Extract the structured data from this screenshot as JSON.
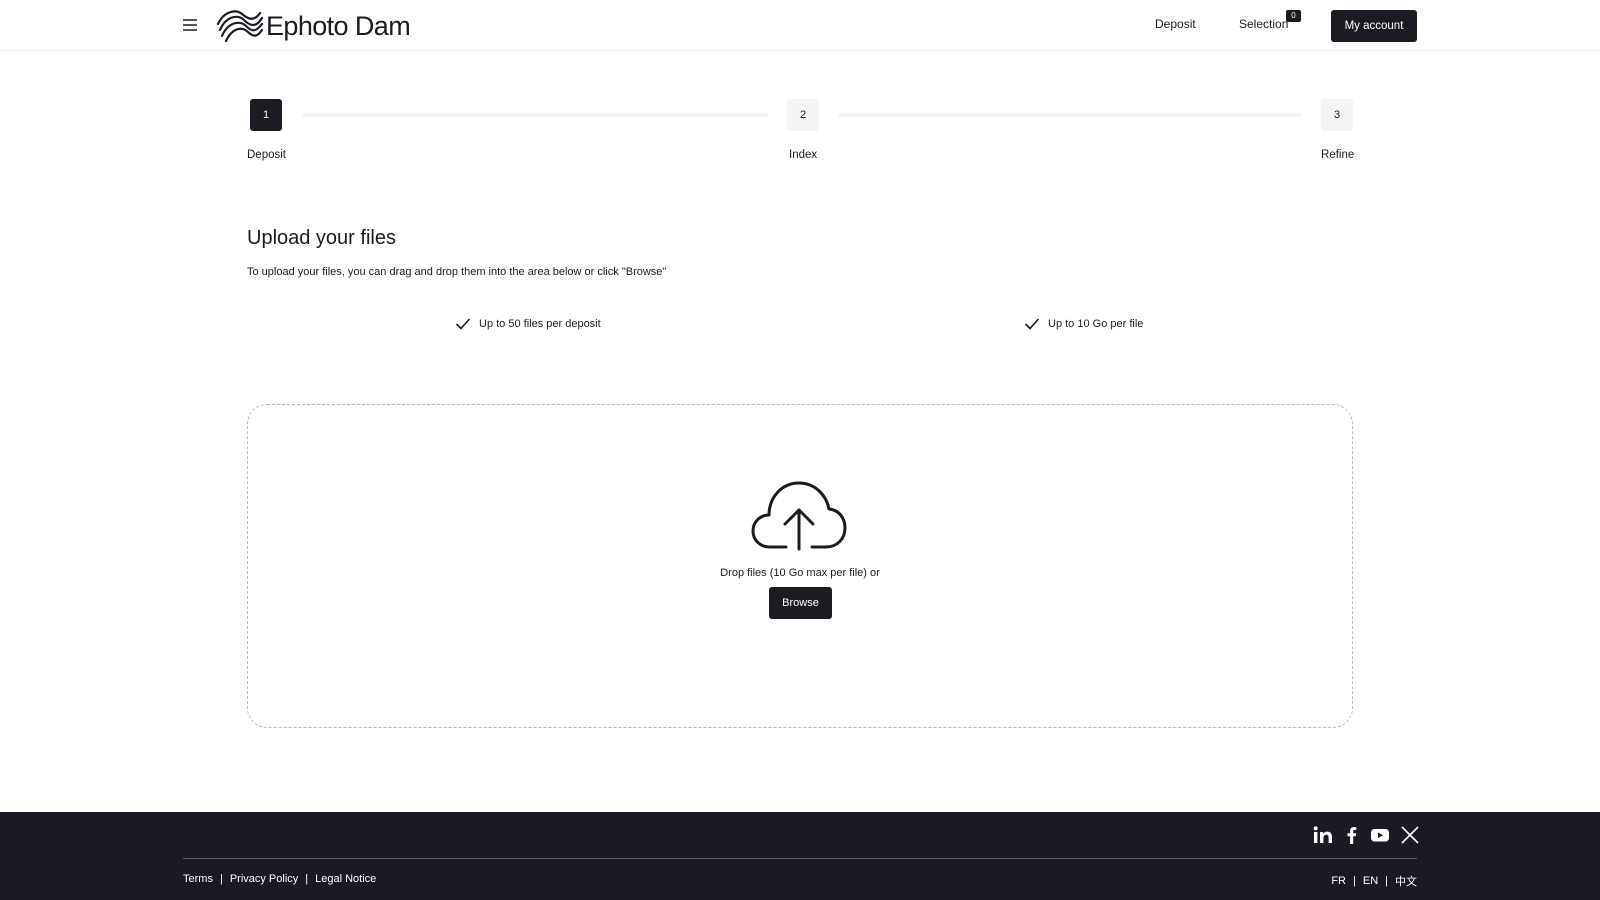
{
  "header": {
    "brand": "Ephoto Dam",
    "nav": {
      "deposit": "Deposit",
      "selection": "Selection",
      "selection_count": "0"
    },
    "account": "My account"
  },
  "stepper": {
    "steps": [
      {
        "number": "1",
        "label": "Deposit"
      },
      {
        "number": "2",
        "label": "Index"
      },
      {
        "number": "3",
        "label": "Refine"
      }
    ]
  },
  "upload": {
    "title": "Upload your files",
    "subtitle": "To upload your files, you can drag and drop them into the area below or click \"Browse\"",
    "features": [
      "Up to 50 files per deposit",
      "Up to 10 Go per file"
    ],
    "drop_text": "Drop files (10 Go max per file) or",
    "browse": "Browse"
  },
  "footer": {
    "social": [
      "linkedin-icon",
      "facebook-icon",
      "youtube-icon",
      "x-icon"
    ],
    "links": [
      "Terms",
      "Privacy Policy",
      "Legal Notice"
    ],
    "languages": [
      "FR",
      "EN",
      "中文"
    ]
  }
}
